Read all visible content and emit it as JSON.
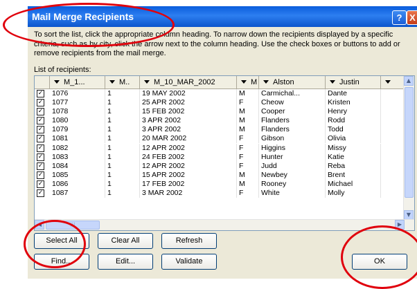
{
  "window": {
    "title": "Mail Merge Recipients",
    "help_glyph": "?",
    "close_glyph": "X"
  },
  "instructions": "To sort the list, click the appropriate column heading.  To narrow down the recipients displayed by a specific criteria, such as by city, click the arrow next to the column heading.  Use the check boxes or buttons to add or remove recipients from the mail merge.",
  "list_label": "List of recipients:",
  "columns": [
    "M_1...",
    "M..",
    "M_10_MAR_2002",
    "M",
    "Alston",
    "Justin",
    ""
  ],
  "rows": [
    [
      "1076",
      "1",
      "19 MAY 2002",
      "M",
      "Carmichal...",
      "Dante"
    ],
    [
      "1077",
      "1",
      "25 APR 2002",
      "F",
      "Cheow",
      "Kristen"
    ],
    [
      "1078",
      "1",
      "15 FEB 2002",
      "M",
      "Cooper",
      "Henry"
    ],
    [
      "1080",
      "1",
      "3 APR 2002",
      "M",
      "Flanders",
      "Rodd"
    ],
    [
      "1079",
      "1",
      "3 APR 2002",
      "M",
      "Flanders",
      "Todd"
    ],
    [
      "1081",
      "1",
      "20 MAR 2002",
      "F",
      "Gibson",
      "Olivia"
    ],
    [
      "1082",
      "1",
      "12 APR 2002",
      "F",
      "Higgins",
      "Missy"
    ],
    [
      "1083",
      "1",
      "24 FEB 2002",
      "F",
      "Hunter",
      "Katie"
    ],
    [
      "1084",
      "1",
      "12 APR 2002",
      "F",
      "Judd",
      "Reba"
    ],
    [
      "1085",
      "1",
      "15 APR 2002",
      "M",
      "Newbey",
      "Brent"
    ],
    [
      "1086",
      "1",
      "17 FEB 2002",
      "M",
      "Rooney",
      "Michael"
    ],
    [
      "1087",
      "1",
      "3 MAR 2002",
      "F",
      "White",
      "Molly"
    ]
  ],
  "checked_glyph": "✓",
  "buttons": {
    "select_all": "Select All",
    "clear_all": "Clear All",
    "refresh": "Refresh",
    "find": "Find...",
    "edit": "Edit...",
    "validate": "Validate",
    "ok": "OK"
  },
  "scroll_glyphs": {
    "up": "▲",
    "down": "▼",
    "left": "◀",
    "right": "▶",
    "grip": "|||"
  },
  "colors": {
    "titlebar": "#0a5ddc",
    "annotation": "#e0000c",
    "dialog_bg": "#ece9d8"
  }
}
